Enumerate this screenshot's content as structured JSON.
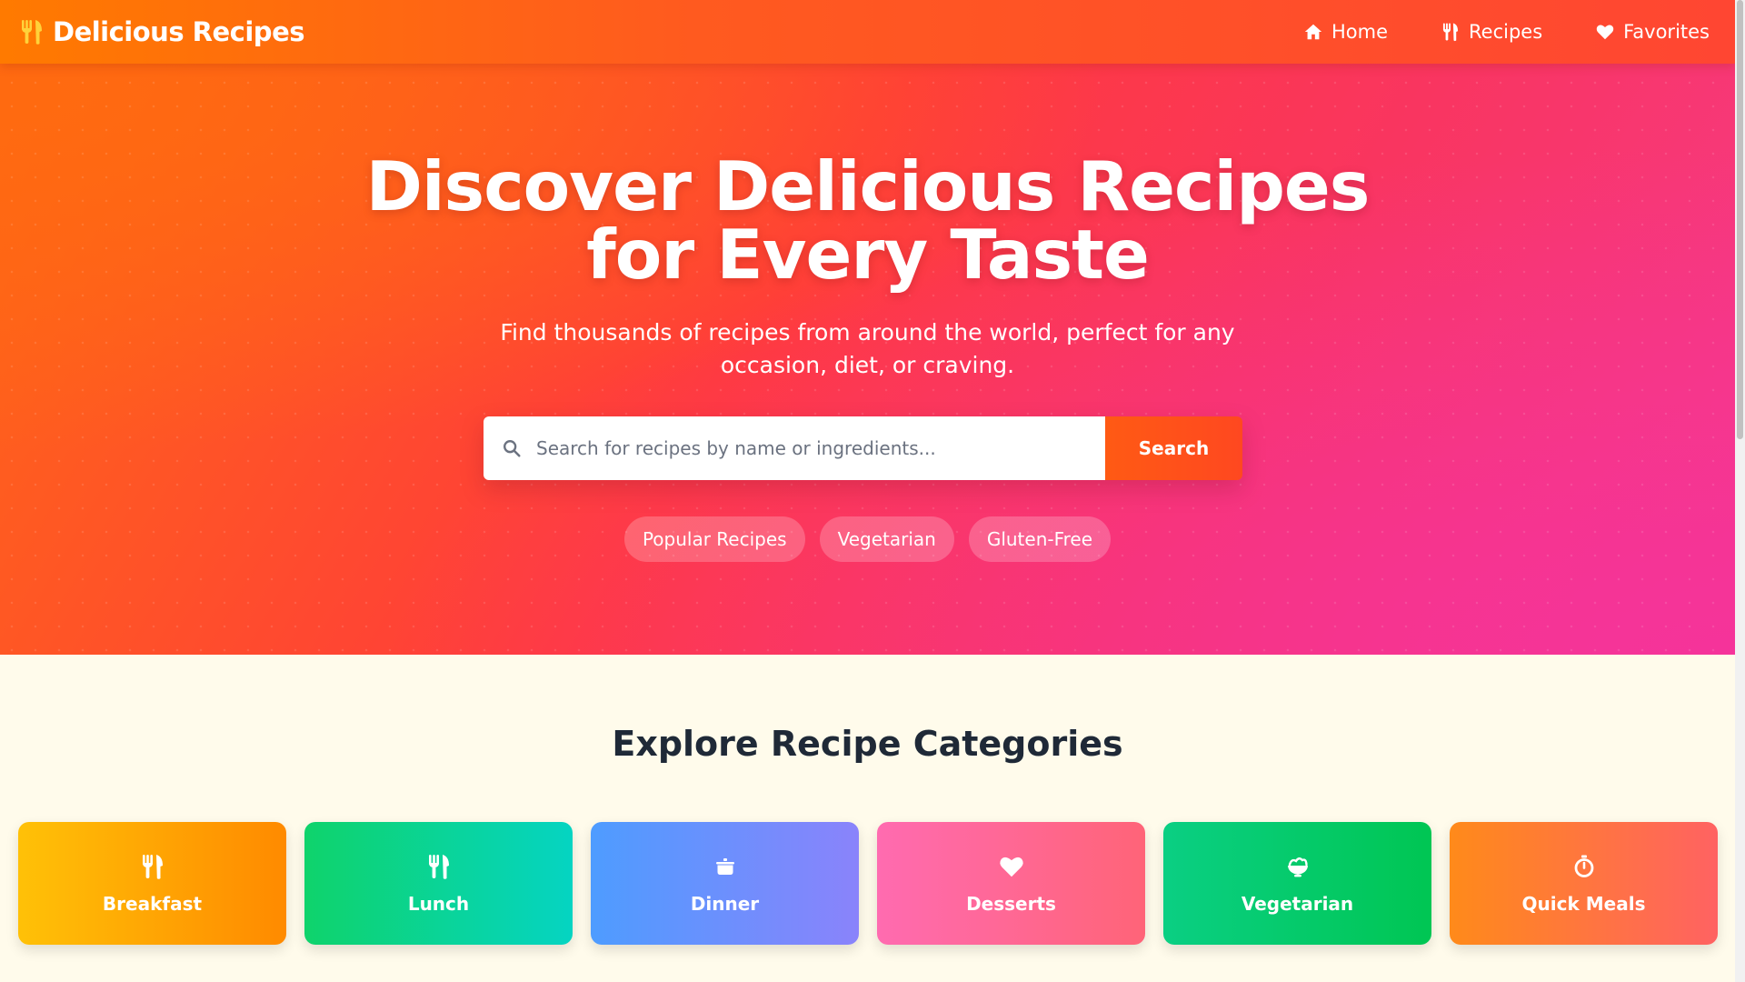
{
  "brand": {
    "title": "Delicious Recipes",
    "icon": "utensils-icon"
  },
  "nav": {
    "items": [
      {
        "label": "Home",
        "icon": "home-icon"
      },
      {
        "label": "Recipes",
        "icon": "utensils-icon"
      },
      {
        "label": "Favorites",
        "icon": "heart-icon"
      }
    ]
  },
  "hero": {
    "title_line1": "Discover Delicious Recipes",
    "title_line2": "for Every Taste",
    "subtitle_line1": "Find thousands of recipes from around the world, perfect for any",
    "subtitle_line2": "occasion, diet, or craving.",
    "search": {
      "placeholder": "Search for recipes by name or ingredients...",
      "value": "",
      "button_label": "Search"
    },
    "tags": [
      "Popular Recipes",
      "Vegetarian",
      "Gluten-Free"
    ]
  },
  "categories": {
    "title": "Explore Recipe Categories",
    "items": [
      {
        "label": "Breakfast",
        "icon": "utensils-icon"
      },
      {
        "label": "Lunch",
        "icon": "utensils-icon"
      },
      {
        "label": "Dinner",
        "icon": "cooking-pot-icon"
      },
      {
        "label": "Desserts",
        "icon": "heart-icon"
      },
      {
        "label": "Vegetarian",
        "icon": "salad-bowl-icon"
      },
      {
        "label": "Quick Meals",
        "icon": "stopwatch-icon"
      }
    ]
  },
  "colors": {
    "header_start": "#ff7a00",
    "header_end": "#ff4632",
    "hero_pink": "#f5339a",
    "page_background": "#fffbeb",
    "heading_text": "#1f2937"
  }
}
